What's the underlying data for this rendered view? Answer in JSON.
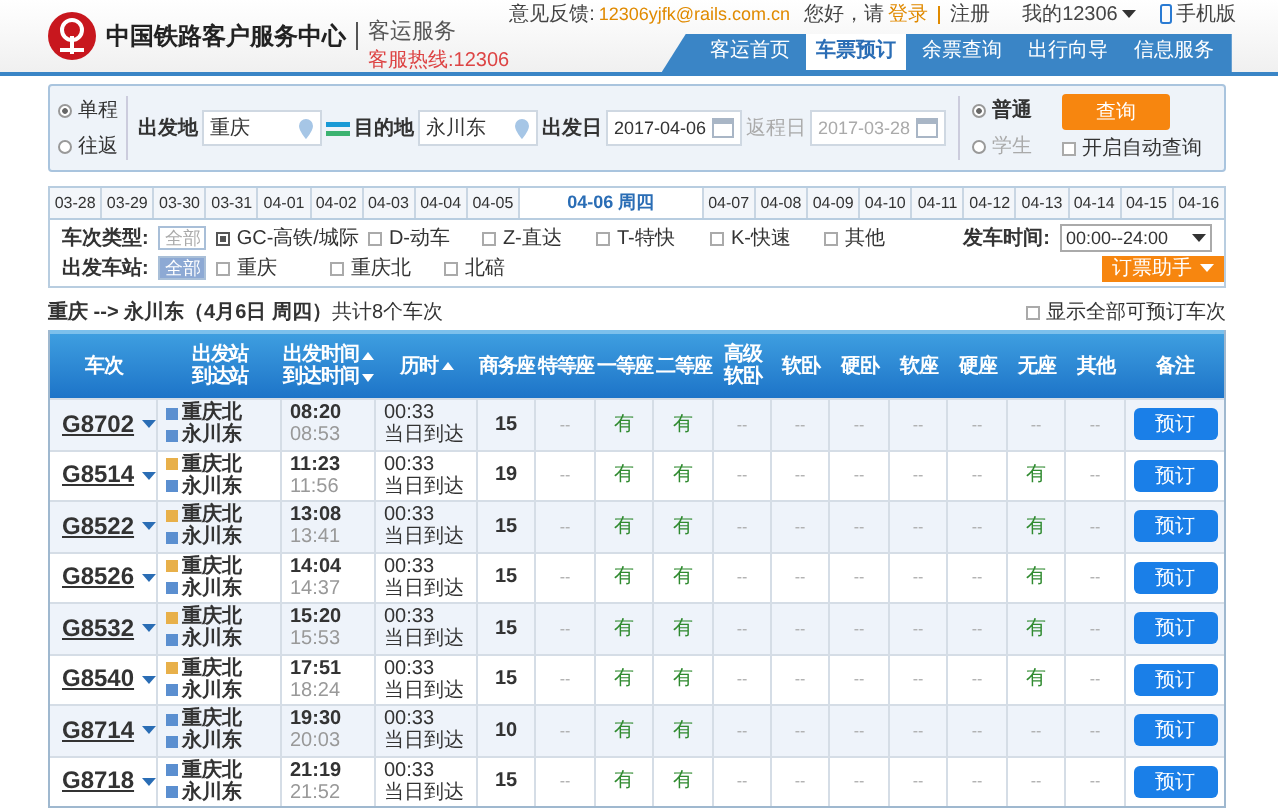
{
  "header": {
    "title": "中国铁路客户服务中心",
    "subtitle": "客运服务",
    "hotline": "客服热线:12306",
    "feedback_label": "意见反馈:",
    "feedback_email": "12306yjfk@rails.com.cn",
    "greeting": "您好，请",
    "login": "登录",
    "register": "注册",
    "account": "我的12306",
    "mobile": "手机版"
  },
  "nav": [
    {
      "label": "客运首页",
      "selected": false
    },
    {
      "label": "车票预订",
      "selected": true
    },
    {
      "label": "余票查询",
      "selected": false
    },
    {
      "label": "出行向导",
      "selected": false
    },
    {
      "label": "信息服务",
      "selected": false
    }
  ],
  "search": {
    "trip_types": [
      {
        "label": "单程",
        "selected": true
      },
      {
        "label": "往返",
        "selected": false
      }
    ],
    "from_label": "出发地",
    "from": "重庆",
    "to_label": "目的地",
    "to": "永川东",
    "date_label": "出发日",
    "date": "2017-04-06",
    "return_label": "返程日",
    "return_date": "2017-03-28",
    "passenger_types": [
      {
        "label": "普通",
        "selected": true,
        "disabled": false
      },
      {
        "label": "学生",
        "selected": false,
        "disabled": true
      }
    ],
    "query_button": "查询",
    "auto_query": {
      "label": "开启自动查询",
      "checked": false
    }
  },
  "dates": [
    {
      "label": "03-28",
      "selected": false
    },
    {
      "label": "03-29",
      "selected": false
    },
    {
      "label": "03-30",
      "selected": false
    },
    {
      "label": "03-31",
      "selected": false
    },
    {
      "label": "04-01",
      "selected": false
    },
    {
      "label": "04-02",
      "selected": false
    },
    {
      "label": "04-03",
      "selected": false
    },
    {
      "label": "04-04",
      "selected": false
    },
    {
      "label": "04-05",
      "selected": false
    },
    {
      "label": "04-06 周四",
      "selected": true
    },
    {
      "label": "04-07",
      "selected": false
    },
    {
      "label": "04-08",
      "selected": false
    },
    {
      "label": "04-09",
      "selected": false
    },
    {
      "label": "04-10",
      "selected": false
    },
    {
      "label": "04-11",
      "selected": false
    },
    {
      "label": "04-12",
      "selected": false
    },
    {
      "label": "04-13",
      "selected": false
    },
    {
      "label": "04-14",
      "selected": false
    },
    {
      "label": "04-15",
      "selected": false
    },
    {
      "label": "04-16",
      "selected": false
    }
  ],
  "filters": {
    "type_label": "车次类型:",
    "type_all": {
      "label": "全部",
      "selected": false
    },
    "types": [
      {
        "label": "GC-高铁/城际",
        "checked": true
      },
      {
        "label": "D-动车",
        "checked": false
      },
      {
        "label": "Z-直达",
        "checked": false
      },
      {
        "label": "T-特快",
        "checked": false
      },
      {
        "label": "K-快速",
        "checked": false
      },
      {
        "label": "其他",
        "checked": false
      }
    ],
    "time_label": "发车时间:",
    "time_value": "00:00--24:00",
    "station_label": "出发车站:",
    "station_all": {
      "label": "全部",
      "selected": true
    },
    "stations": [
      {
        "label": "重庆",
        "checked": false
      },
      {
        "label": "重庆北",
        "checked": false
      },
      {
        "label": "北碚",
        "checked": false
      }
    ],
    "helper_button": "订票助手"
  },
  "summary": {
    "text": "**重庆 --> 永川东（4月6日  周四）**共计8个车次",
    "show_all": {
      "label": "显示全部可预订车次",
      "checked": false
    }
  },
  "table": {
    "columns": [
      {
        "lines": [
          {
            "text": "车次"
          }
        ]
      },
      {
        "lines": [
          {
            "text": "出发站"
          },
          {
            "text": "到达站"
          }
        ]
      },
      {
        "lines": [
          {
            "text": "出发时间",
            "sort_ascending": true
          },
          {
            "text": "到达时间",
            "sort_ascending": false
          }
        ]
      },
      {
        "lines": [
          {
            "text": "历时",
            "sort_ascending": true
          }
        ]
      },
      {
        "lines": [
          {
            "text": "商务座"
          }
        ]
      },
      {
        "lines": [
          {
            "text": "特等座"
          }
        ]
      },
      {
        "lines": [
          {
            "text": "一等座"
          }
        ]
      },
      {
        "lines": [
          {
            "text": "二等座"
          }
        ]
      },
      {
        "lines": [
          {
            "text": "高级"
          },
          {
            "text": "软卧"
          }
        ]
      },
      {
        "lines": [
          {
            "text": "软卧"
          }
        ]
      },
      {
        "lines": [
          {
            "text": "硬卧"
          }
        ]
      },
      {
        "lines": [
          {
            "text": "软座"
          }
        ]
      },
      {
        "lines": [
          {
            "text": "硬座"
          }
        ]
      },
      {
        "lines": [
          {
            "text": "无座"
          }
        ]
      },
      {
        "lines": [
          {
            "text": "其他"
          }
        ]
      },
      {
        "lines": [
          {
            "text": "备注"
          }
        ]
      }
    ],
    "rows": [
      {
        "train": "G8702",
        "from": "重庆北",
        "from_is_start": false,
        "to": "永川东",
        "to_is_start": false,
        "depart": "08:20",
        "arrive": "08:53",
        "duration": "00:33",
        "arrival_day": "当日到达",
        "seats": [
          {
            "text": "15",
            "kind": "count"
          },
          {
            "text": "--",
            "kind": "none"
          },
          {
            "text": "有",
            "kind": "yes"
          },
          {
            "text": "有",
            "kind": "yes"
          },
          {
            "text": "--",
            "kind": "none"
          },
          {
            "text": "--",
            "kind": "none"
          },
          {
            "text": "--",
            "kind": "none"
          },
          {
            "text": "--",
            "kind": "none"
          },
          {
            "text": "--",
            "kind": "none"
          },
          {
            "text": "--",
            "kind": "none"
          },
          {
            "text": "--",
            "kind": "none"
          }
        ],
        "button": "预订"
      },
      {
        "train": "G8514",
        "from": "重庆北",
        "from_is_start": true,
        "to": "永川东",
        "to_is_start": false,
        "depart": "11:23",
        "arrive": "11:56",
        "duration": "00:33",
        "arrival_day": "当日到达",
        "seats": [
          {
            "text": "19",
            "kind": "count"
          },
          {
            "text": "--",
            "kind": "none"
          },
          {
            "text": "有",
            "kind": "yes"
          },
          {
            "text": "有",
            "kind": "yes"
          },
          {
            "text": "--",
            "kind": "none"
          },
          {
            "text": "--",
            "kind": "none"
          },
          {
            "text": "--",
            "kind": "none"
          },
          {
            "text": "--",
            "kind": "none"
          },
          {
            "text": "--",
            "kind": "none"
          },
          {
            "text": "有",
            "kind": "yes"
          },
          {
            "text": "--",
            "kind": "none"
          }
        ],
        "button": "预订"
      },
      {
        "train": "G8522",
        "from": "重庆北",
        "from_is_start": true,
        "to": "永川东",
        "to_is_start": false,
        "depart": "13:08",
        "arrive": "13:41",
        "duration": "00:33",
        "arrival_day": "当日到达",
        "seats": [
          {
            "text": "15",
            "kind": "count"
          },
          {
            "text": "--",
            "kind": "none"
          },
          {
            "text": "有",
            "kind": "yes"
          },
          {
            "text": "有",
            "kind": "yes"
          },
          {
            "text": "--",
            "kind": "none"
          },
          {
            "text": "--",
            "kind": "none"
          },
          {
            "text": "--",
            "kind": "none"
          },
          {
            "text": "--",
            "kind": "none"
          },
          {
            "text": "--",
            "kind": "none"
          },
          {
            "text": "有",
            "kind": "yes"
          },
          {
            "text": "--",
            "kind": "none"
          }
        ],
        "button": "预订"
      },
      {
        "train": "G8526",
        "from": "重庆北",
        "from_is_start": true,
        "to": "永川东",
        "to_is_start": false,
        "depart": "14:04",
        "arrive": "14:37",
        "duration": "00:33",
        "arrival_day": "当日到达",
        "seats": [
          {
            "text": "15",
            "kind": "count"
          },
          {
            "text": "--",
            "kind": "none"
          },
          {
            "text": "有",
            "kind": "yes"
          },
          {
            "text": "有",
            "kind": "yes"
          },
          {
            "text": "--",
            "kind": "none"
          },
          {
            "text": "--",
            "kind": "none"
          },
          {
            "text": "--",
            "kind": "none"
          },
          {
            "text": "--",
            "kind": "none"
          },
          {
            "text": "--",
            "kind": "none"
          },
          {
            "text": "有",
            "kind": "yes"
          },
          {
            "text": "--",
            "kind": "none"
          }
        ],
        "button": "预订"
      },
      {
        "train": "G8532",
        "from": "重庆北",
        "from_is_start": true,
        "to": "永川东",
        "to_is_start": false,
        "depart": "15:20",
        "arrive": "15:53",
        "duration": "00:33",
        "arrival_day": "当日到达",
        "seats": [
          {
            "text": "15",
            "kind": "count"
          },
          {
            "text": "--",
            "kind": "none"
          },
          {
            "text": "有",
            "kind": "yes"
          },
          {
            "text": "有",
            "kind": "yes"
          },
          {
            "text": "--",
            "kind": "none"
          },
          {
            "text": "--",
            "kind": "none"
          },
          {
            "text": "--",
            "kind": "none"
          },
          {
            "text": "--",
            "kind": "none"
          },
          {
            "text": "--",
            "kind": "none"
          },
          {
            "text": "有",
            "kind": "yes"
          },
          {
            "text": "--",
            "kind": "none"
          }
        ],
        "button": "预订"
      },
      {
        "train": "G8540",
        "from": "重庆北",
        "from_is_start": true,
        "to": "永川东",
        "to_is_start": false,
        "depart": "17:51",
        "arrive": "18:24",
        "duration": "00:33",
        "arrival_day": "当日到达",
        "seats": [
          {
            "text": "15",
            "kind": "count"
          },
          {
            "text": "--",
            "kind": "none"
          },
          {
            "text": "有",
            "kind": "yes"
          },
          {
            "text": "有",
            "kind": "yes"
          },
          {
            "text": "--",
            "kind": "none"
          },
          {
            "text": "--",
            "kind": "none"
          },
          {
            "text": "--",
            "kind": "none"
          },
          {
            "text": "--",
            "kind": "none"
          },
          {
            "text": "--",
            "kind": "none"
          },
          {
            "text": "有",
            "kind": "yes"
          },
          {
            "text": "--",
            "kind": "none"
          }
        ],
        "button": "预订"
      },
      {
        "train": "G8714",
        "from": "重庆北",
        "from_is_start": false,
        "to": "永川东",
        "to_is_start": false,
        "depart": "19:30",
        "arrive": "20:03",
        "duration": "00:33",
        "arrival_day": "当日到达",
        "seats": [
          {
            "text": "10",
            "kind": "count"
          },
          {
            "text": "--",
            "kind": "none"
          },
          {
            "text": "有",
            "kind": "yes"
          },
          {
            "text": "有",
            "kind": "yes"
          },
          {
            "text": "--",
            "kind": "none"
          },
          {
            "text": "--",
            "kind": "none"
          },
          {
            "text": "--",
            "kind": "none"
          },
          {
            "text": "--",
            "kind": "none"
          },
          {
            "text": "--",
            "kind": "none"
          },
          {
            "text": "--",
            "kind": "none"
          },
          {
            "text": "--",
            "kind": "none"
          }
        ],
        "button": "预订"
      },
      {
        "train": "G8718",
        "from": "重庆北",
        "from_is_start": false,
        "to": "永川东",
        "to_is_start": false,
        "depart": "21:19",
        "arrive": "21:52",
        "duration": "00:33",
        "arrival_day": "当日到达",
        "seats": [
          {
            "text": "15",
            "kind": "count"
          },
          {
            "text": "--",
            "kind": "none"
          },
          {
            "text": "有",
            "kind": "yes"
          },
          {
            "text": "有",
            "kind": "yes"
          },
          {
            "text": "--",
            "kind": "none"
          },
          {
            "text": "--",
            "kind": "none"
          },
          {
            "text": "--",
            "kind": "none"
          },
          {
            "text": "--",
            "kind": "none"
          },
          {
            "text": "--",
            "kind": "none"
          },
          {
            "text": "--",
            "kind": "none"
          },
          {
            "text": "--",
            "kind": "none"
          }
        ],
        "button": "预订"
      }
    ]
  }
}
